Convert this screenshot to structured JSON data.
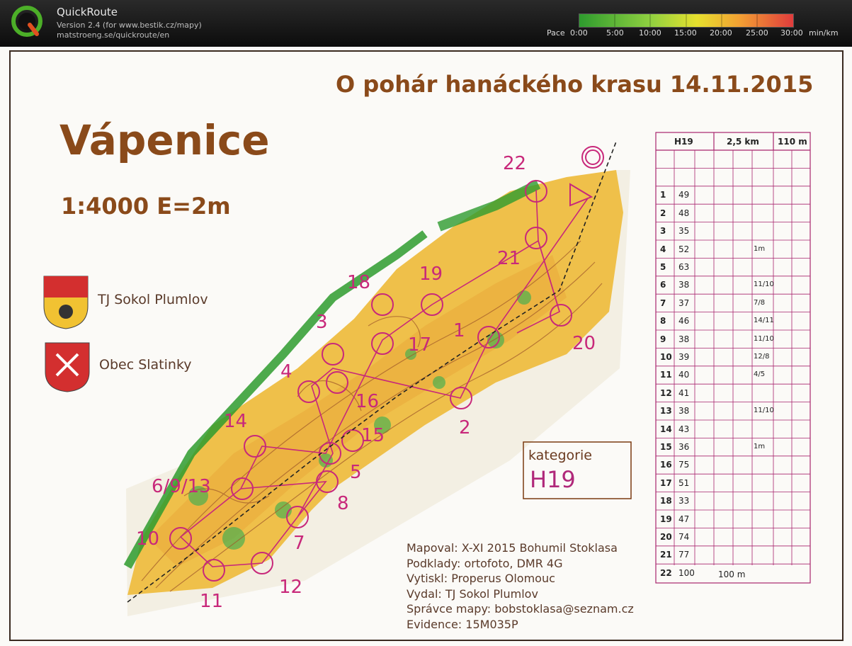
{
  "app": {
    "title": "QuickRoute",
    "version": "Version 2.4  (for www.bestik.cz/mapy)",
    "website": "matstroeng.se/quickroute/en"
  },
  "pace_scale": {
    "label": "Pace",
    "ticks": [
      "0:00",
      "5:00",
      "10:00",
      "15:00",
      "20:00",
      "25:00",
      "30:00"
    ],
    "unit": "min/km",
    "colors": [
      "#2e9b2e",
      "#6cc040",
      "#a8d63a",
      "#e6e02e",
      "#f2b632",
      "#ef7a33",
      "#e03c3c"
    ]
  },
  "map": {
    "event_title": "O pohár hanáckého krasu 14.11.2015",
    "map_name": "Vápenice",
    "scale": "1:4000 E=2m",
    "logos": [
      {
        "label": "TJ Sokol Plumlov",
        "icon": "club-crest-icon"
      },
      {
        "label": "Obec Slatinky",
        "icon": "municipal-crest-icon"
      }
    ],
    "category_box": {
      "label": "kategorie",
      "value": "H19"
    },
    "credits": [
      "Mapoval: X-XI 2015 Bohumil Stoklasa",
      "Podklady: ortofoto, DMR 4G",
      "Vytiskl: Properus Olomouc",
      "Vydal: TJ Sokol Plumlov",
      "Správce mapy: bobstoklasa@seznam.cz",
      "Evidence: 15M035P"
    ],
    "controls": [
      {
        "label": "1"
      },
      {
        "label": "2"
      },
      {
        "label": "3"
      },
      {
        "label": "4"
      },
      {
        "label": "5"
      },
      {
        "label": "6/9/13"
      },
      {
        "label": "7"
      },
      {
        "label": "8"
      },
      {
        "label": "10"
      },
      {
        "label": "11"
      },
      {
        "label": "12"
      },
      {
        "label": "14"
      },
      {
        "label": "15"
      },
      {
        "label": "16"
      },
      {
        "label": "17"
      },
      {
        "label": "18"
      },
      {
        "label": "19"
      },
      {
        "label": "20"
      },
      {
        "label": "21"
      },
      {
        "label": "22"
      }
    ]
  },
  "control_description": {
    "header": {
      "category": "H19",
      "length": "2,5 km",
      "climb": "110 m"
    },
    "rows": [
      {
        "num": "1",
        "code": "49",
        "note": ""
      },
      {
        "num": "2",
        "code": "48",
        "note": ""
      },
      {
        "num": "3",
        "code": "35",
        "note": ""
      },
      {
        "num": "4",
        "code": "52",
        "note": "1m"
      },
      {
        "num": "5",
        "code": "63",
        "note": ""
      },
      {
        "num": "6",
        "code": "38",
        "note": "11/10"
      },
      {
        "num": "7",
        "code": "37",
        "note": "7/8"
      },
      {
        "num": "8",
        "code": "46",
        "note": "14/11"
      },
      {
        "num": "9",
        "code": "38",
        "note": "11/10"
      },
      {
        "num": "10",
        "code": "39",
        "note": "12/8"
      },
      {
        "num": "11",
        "code": "40",
        "note": "4/5"
      },
      {
        "num": "12",
        "code": "41",
        "note": ""
      },
      {
        "num": "13",
        "code": "38",
        "note": "11/10"
      },
      {
        "num": "14",
        "code": "43",
        "note": ""
      },
      {
        "num": "15",
        "code": "36",
        "note": "1m"
      },
      {
        "num": "16",
        "code": "75",
        "note": ""
      },
      {
        "num": "17",
        "code": "51",
        "note": ""
      },
      {
        "num": "18",
        "code": "33",
        "note": ""
      },
      {
        "num": "19",
        "code": "47",
        "note": ""
      },
      {
        "num": "20",
        "code": "74",
        "note": ""
      },
      {
        "num": "21",
        "code": "77",
        "note": ""
      },
      {
        "num": "22",
        "code": "100",
        "note": ""
      }
    ],
    "finish_distance": "100 m"
  }
}
